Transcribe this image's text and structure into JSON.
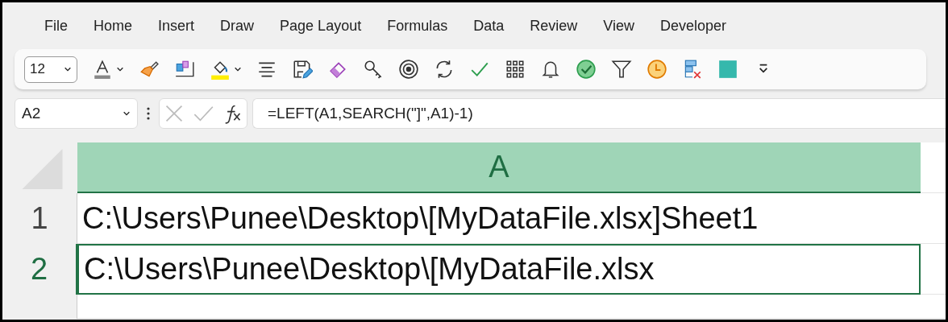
{
  "menu": [
    {
      "label": "File",
      "selected": false
    },
    {
      "label": "Home",
      "selected": false
    },
    {
      "label": "Insert",
      "selected": false
    },
    {
      "label": "Draw",
      "selected": false
    },
    {
      "label": "Page Layout",
      "selected": false
    },
    {
      "label": "Formulas",
      "selected": false
    },
    {
      "label": "Data",
      "selected": false
    },
    {
      "label": "Review",
      "selected": false
    },
    {
      "label": "View",
      "selected": false
    },
    {
      "label": "Developer",
      "selected": false
    }
  ],
  "toolbar": {
    "font_size": "12"
  },
  "name_box": "A2",
  "formula": "=LEFT(A1,SEARCH(\"]\",A1)-1)",
  "columns": [
    {
      "label": "A",
      "selected": true
    }
  ],
  "rows": [
    {
      "number": "1",
      "cell": "C:\\Users\\Punee\\Desktop\\[MyDataFile.xlsx]Sheet1",
      "selected": false
    },
    {
      "number": "2",
      "cell": "C:\\Users\\Punee\\Desktop\\[MyDataFile.xlsx",
      "selected": true
    }
  ]
}
